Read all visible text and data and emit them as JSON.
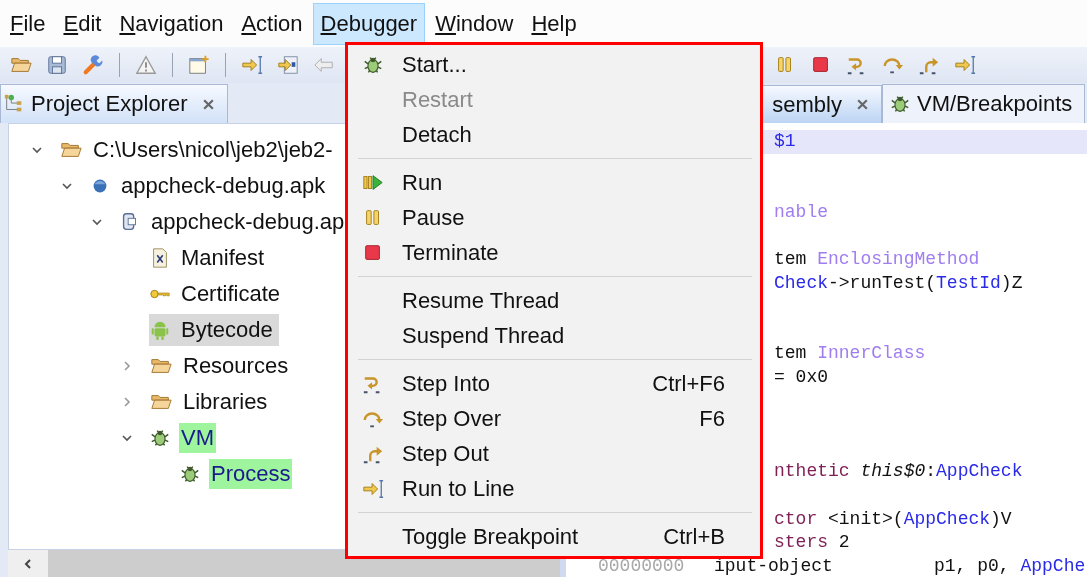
{
  "menubar": [
    {
      "label": "File",
      "selected": false
    },
    {
      "label": "Edit",
      "selected": false
    },
    {
      "label": "Navigation",
      "selected": false
    },
    {
      "label": "Action",
      "selected": false
    },
    {
      "label": "Debugger",
      "selected": true
    },
    {
      "label": "Window",
      "selected": false
    },
    {
      "label": "Help",
      "selected": false
    }
  ],
  "explorer": {
    "tabs": [
      {
        "label": "Project Explorer",
        "kind": "tree",
        "selected": true,
        "closable": true
      }
    ],
    "tree": [
      {
        "label": "C:\\Users\\nicol\\jeb2\\jeb2-",
        "kind": "folder",
        "expanded": true,
        "selected": false,
        "highlighted": false,
        "children": [
          {
            "label": "appcheck-debug.apk",
            "kind": "apk",
            "expanded": true,
            "selected": false,
            "highlighted": false,
            "children": [
              {
                "label": "appcheck-debug.ap",
                "kind": "dex",
                "expanded": true,
                "selected": false,
                "highlighted": false,
                "children": [
                  {
                    "label": "Manifest",
                    "kind": "xml",
                    "selected": false,
                    "highlighted": false
                  },
                  {
                    "label": "Certificate",
                    "kind": "key",
                    "selected": false,
                    "highlighted": false
                  },
                  {
                    "label": "Bytecode",
                    "kind": "robot",
                    "selected": true,
                    "highlighted": false
                  },
                  {
                    "label": "Resources",
                    "kind": "folder",
                    "expanded": false,
                    "selected": false,
                    "highlighted": false
                  },
                  {
                    "label": "Libraries",
                    "kind": "folder",
                    "expanded": false,
                    "selected": false,
                    "highlighted": false
                  },
                  {
                    "label": "VM",
                    "kind": "bug",
                    "expanded": true,
                    "selected": false,
                    "highlighted": true,
                    "children": [
                      {
                        "label": "Process",
                        "kind": "bug",
                        "selected": false,
                        "highlighted": true
                      }
                    ]
                  }
                ]
              }
            ]
          }
        ]
      }
    ]
  },
  "editor": {
    "tabs": [
      {
        "label": "sembly",
        "kind": "plain",
        "selected": true,
        "closable": true
      },
      {
        "label": "VM/Breakpoints",
        "kind": "bug",
        "selected": false,
        "closable": false
      }
    ],
    "lines": [
      {
        "kind": "text",
        "current": true,
        "segments": [
          {
            "kind": "class",
            "text": "$1"
          }
        ]
      },
      {
        "kind": "text",
        "current": false
      },
      {
        "kind": "text",
        "current": false
      },
      {
        "kind": "text",
        "current": false,
        "segments": [
          {
            "kind": "type",
            "text": "nable"
          }
        ]
      },
      {
        "kind": "text",
        "current": false
      },
      {
        "kind": "text",
        "current": false,
        "segments": [
          {
            "kind": "plain",
            "text": "tem "
          },
          {
            "kind": "type",
            "text": "EnclosingMethod"
          }
        ]
      },
      {
        "kind": "text",
        "current": false,
        "segments": [
          {
            "kind": "class",
            "text": "Check"
          },
          {
            "kind": "plain",
            "text": "->runTest("
          },
          {
            "kind": "class",
            "text": "TestId"
          },
          {
            "kind": "plain",
            "text": ")Z"
          }
        ]
      },
      {
        "kind": "text",
        "current": false
      },
      {
        "kind": "text",
        "current": false
      },
      {
        "kind": "text",
        "current": false,
        "segments": [
          {
            "kind": "plain",
            "text": "tem "
          },
          {
            "kind": "type",
            "text": "InnerClass"
          }
        ]
      },
      {
        "kind": "text",
        "current": false,
        "segments": [
          {
            "kind": "plain",
            "text": "= 0x0"
          }
        ]
      },
      {
        "kind": "text",
        "current": false
      },
      {
        "kind": "text",
        "current": false
      },
      {
        "kind": "text",
        "current": false
      },
      {
        "kind": "text",
        "current": false,
        "segments": [
          {
            "kind": "keyword",
            "text": "nthetic "
          },
          {
            "kind": "field",
            "text": "this$0"
          },
          {
            "kind": "plain",
            "text": ":"
          },
          {
            "kind": "class",
            "text": "AppCheck"
          }
        ]
      },
      {
        "kind": "text",
        "current": false
      },
      {
        "kind": "text",
        "current": false,
        "segments": [
          {
            "kind": "keyword",
            "text": "ctor "
          },
          {
            "kind": "plain",
            "text": "<init>("
          },
          {
            "kind": "class",
            "text": "AppCheck"
          },
          {
            "kind": "plain",
            "text": ")V"
          }
        ]
      },
      {
        "kind": "text",
        "current": false,
        "segments": [
          {
            "kind": "keyword",
            "text": "sters "
          },
          {
            "kind": "plain",
            "text": "2"
          }
        ]
      },
      {
        "kind": "instruction",
        "current": false,
        "address": "00000000",
        "opcode": "iput-object",
        "segments": [
          {
            "kind": "plain",
            "text": "p1, p0, "
          },
          {
            "kind": "class",
            "text": "AppChe"
          }
        ]
      }
    ]
  },
  "debugger_menu": [
    {
      "kind": "bug",
      "label": "Start...",
      "disabled": false
    },
    {
      "kind": "plain",
      "label": "Restart",
      "disabled": true
    },
    {
      "kind": "plain",
      "label": "Detach",
      "disabled": false
    },
    {
      "kind": "separator"
    },
    {
      "kind": "run",
      "label": "Run",
      "disabled": false
    },
    {
      "kind": "pause",
      "label": "Pause",
      "disabled": false
    },
    {
      "kind": "stop",
      "label": "Terminate",
      "disabled": false
    },
    {
      "kind": "separator"
    },
    {
      "kind": "plain",
      "label": "Resume Thread",
      "disabled": false
    },
    {
      "kind": "plain",
      "label": "Suspend Thread",
      "disabled": false
    },
    {
      "kind": "separator"
    },
    {
      "kind": "stepinto",
      "label": "Step Into",
      "shortcut": "Ctrl+F6",
      "disabled": false
    },
    {
      "kind": "stepover",
      "label": "Step Over",
      "shortcut": "F6",
      "disabled": false
    },
    {
      "kind": "stepout",
      "label": "Step Out",
      "disabled": false
    },
    {
      "kind": "runtoline",
      "label": "Run to Line",
      "disabled": false
    },
    {
      "kind": "separator"
    },
    {
      "kind": "plain",
      "label": "Toggle Breakpoint",
      "shortcut": "Ctrl+B",
      "disabled": false
    }
  ]
}
